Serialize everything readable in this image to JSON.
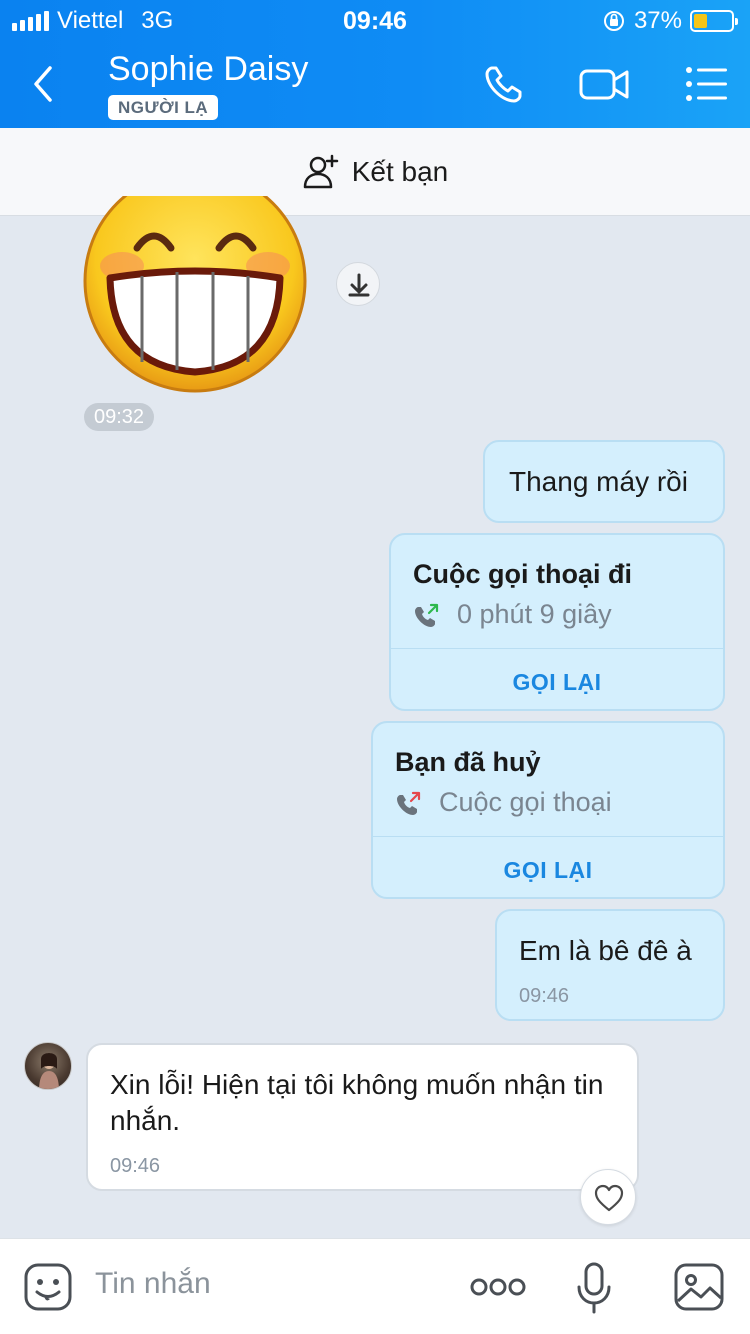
{
  "status_bar": {
    "carrier": "Viettel",
    "network": "3G",
    "time": "09:46",
    "battery_percent": "37%",
    "battery_level": 0.37
  },
  "header": {
    "contact_name": "Sophie Daisy",
    "badge": "NGƯỜI LẠ"
  },
  "friend_bar": {
    "label": "Kết bạn"
  },
  "messages": {
    "sticker_time": "09:32",
    "m1_text": "Thang máy rồi",
    "call1": {
      "title": "Cuộc gọi thoại đi",
      "subtitle": "0 phút 9 giây",
      "action": "GỌI LẠI"
    },
    "call2": {
      "title": "Bạn đã huỷ",
      "subtitle": "Cuộc gọi thoại",
      "action": "GỌI LẠI"
    },
    "m2_text": "Em là bê đê à",
    "m2_time": "09:46",
    "reply_text": "Xin lỗi! Hiện tại tôi không muốn nhận tin nhắn.",
    "reply_time": "09:46"
  },
  "input_bar": {
    "placeholder": "Tin nhắn"
  },
  "colors": {
    "header_blue": "#0a82f0",
    "bubble_sent": "#d4effd",
    "bubble_received": "#ffffff",
    "action_blue": "#1a87e0",
    "call_out_green": "#2db84d",
    "call_cancel_red": "#e5484d"
  },
  "icons": [
    "back-icon",
    "phone-icon",
    "video-icon",
    "menu-icon",
    "add-friend-icon",
    "download-icon",
    "phone-outgoing-icon",
    "heart-icon",
    "emoji-icon",
    "more-icon",
    "mic-icon",
    "image-icon"
  ]
}
